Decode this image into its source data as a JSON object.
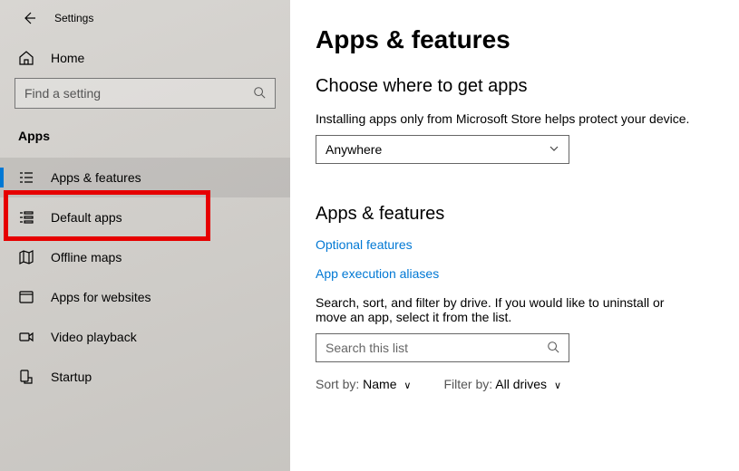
{
  "window": {
    "title": "Settings"
  },
  "sidebar": {
    "search_placeholder": "Find a setting",
    "home_label": "Home",
    "category": "Apps",
    "items": [
      {
        "label": "Apps & features"
      },
      {
        "label": "Default apps"
      },
      {
        "label": "Offline maps"
      },
      {
        "label": "Apps for websites"
      },
      {
        "label": "Video playback"
      },
      {
        "label": "Startup"
      }
    ]
  },
  "main": {
    "title": "Apps & features",
    "choose_header": "Choose where to get apps",
    "choose_desc": "Installing apps only from Microsoft Store helps protect your device.",
    "choose_value": "Anywhere",
    "apps_header": "Apps & features",
    "link_optional": "Optional features",
    "link_aliases": "App execution aliases",
    "filter_desc": "Search, sort, and filter by drive. If you would like to uninstall or move an app, select it from the list.",
    "search_placeholder": "Search this list",
    "sort_label": "Sort by:",
    "sort_value": "Name",
    "filter_label": "Filter by:",
    "filter_value": "All drives"
  }
}
